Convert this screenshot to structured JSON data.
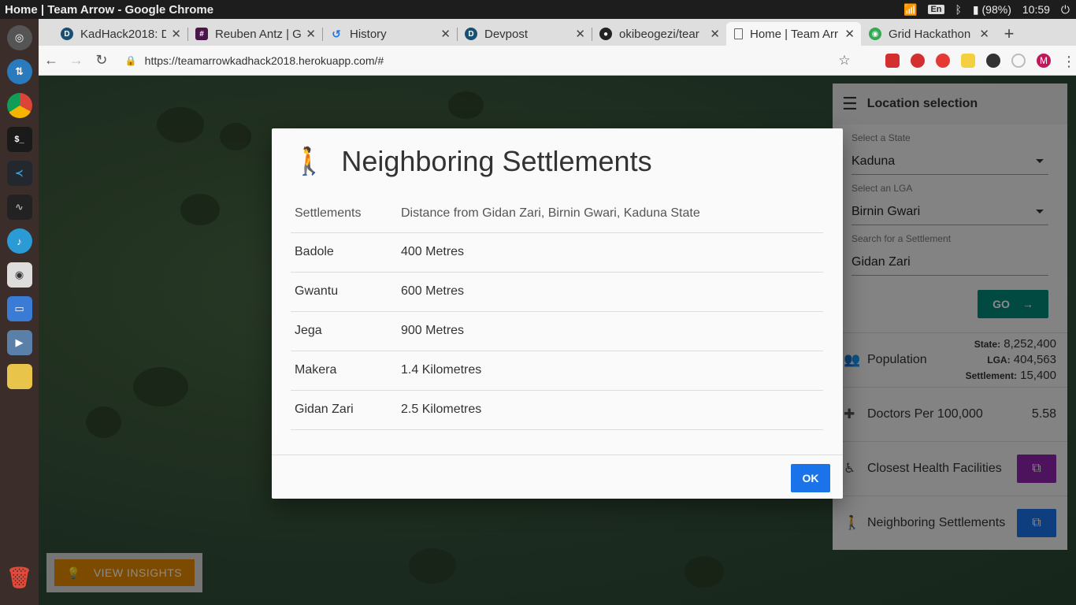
{
  "os": {
    "window_title": "Home | Team Arrow - Google Chrome",
    "keyboard": "En",
    "battery": "(98%)",
    "time": "10:59"
  },
  "browser": {
    "tabs": [
      {
        "label": "KadHack2018: D",
        "favicon": "D",
        "color": "#1b4f72"
      },
      {
        "label": "Reuben Antz | G",
        "favicon": "#",
        "color": "#4a154b"
      },
      {
        "label": "History",
        "favicon": "↺",
        "color": "#1a73e8"
      },
      {
        "label": "Devpost",
        "favicon": "D",
        "color": "#1b4f72"
      },
      {
        "label": "okibeogezi/tear",
        "favicon": "●",
        "color": "#222222"
      },
      {
        "label": "Home | Team Arr",
        "favicon": "▯",
        "color": "#666666"
      },
      {
        "label": "Grid Hackathon",
        "favicon": "◉",
        "color": "#34a853"
      }
    ],
    "url": "https://teamarrowkadhack2018.herokuapp.com/#",
    "profile_initial": "M"
  },
  "panel": {
    "title": "Location selection",
    "state_label": "Select a State",
    "state_value": "Kaduna",
    "lga_label": "Select an LGA",
    "lga_value": "Birnin Gwari",
    "settlement_label": "Search for a Settlement",
    "settlement_value": "Gidan Zari",
    "go_label": "GO",
    "population_label": "Population",
    "population": {
      "state_label": "State:",
      "state": "8,252,400",
      "lga_label": "LGA:",
      "lga": "404,563",
      "settlement_label": "Settlement:",
      "settlement": "15,400"
    },
    "doctors_label": "Doctors Per 100,000",
    "doctors_value": "5.58",
    "health_label": "Closest Health Facilities",
    "health_color": "#8e24aa",
    "neighbors_label": "Neighboring Settlements",
    "neighbors_color": "#1a73e8"
  },
  "insights_label": "VIEW INSIGHTS",
  "dialog": {
    "title": "Neighboring Settlements",
    "col_settlement": "Settlements",
    "col_distance": "Distance from Gidan Zari, Birnin Gwari, Kaduna State",
    "rows": [
      {
        "name": "Badole",
        "distance": "400 Metres"
      },
      {
        "name": "Gwantu",
        "distance": "600 Metres"
      },
      {
        "name": "Jega",
        "distance": "900 Metres"
      },
      {
        "name": "Makera",
        "distance": "1.4 Kilometres"
      },
      {
        "name": "Gidan Zari",
        "distance": "2.5 Kilometres"
      }
    ],
    "ok_label": "OK"
  }
}
